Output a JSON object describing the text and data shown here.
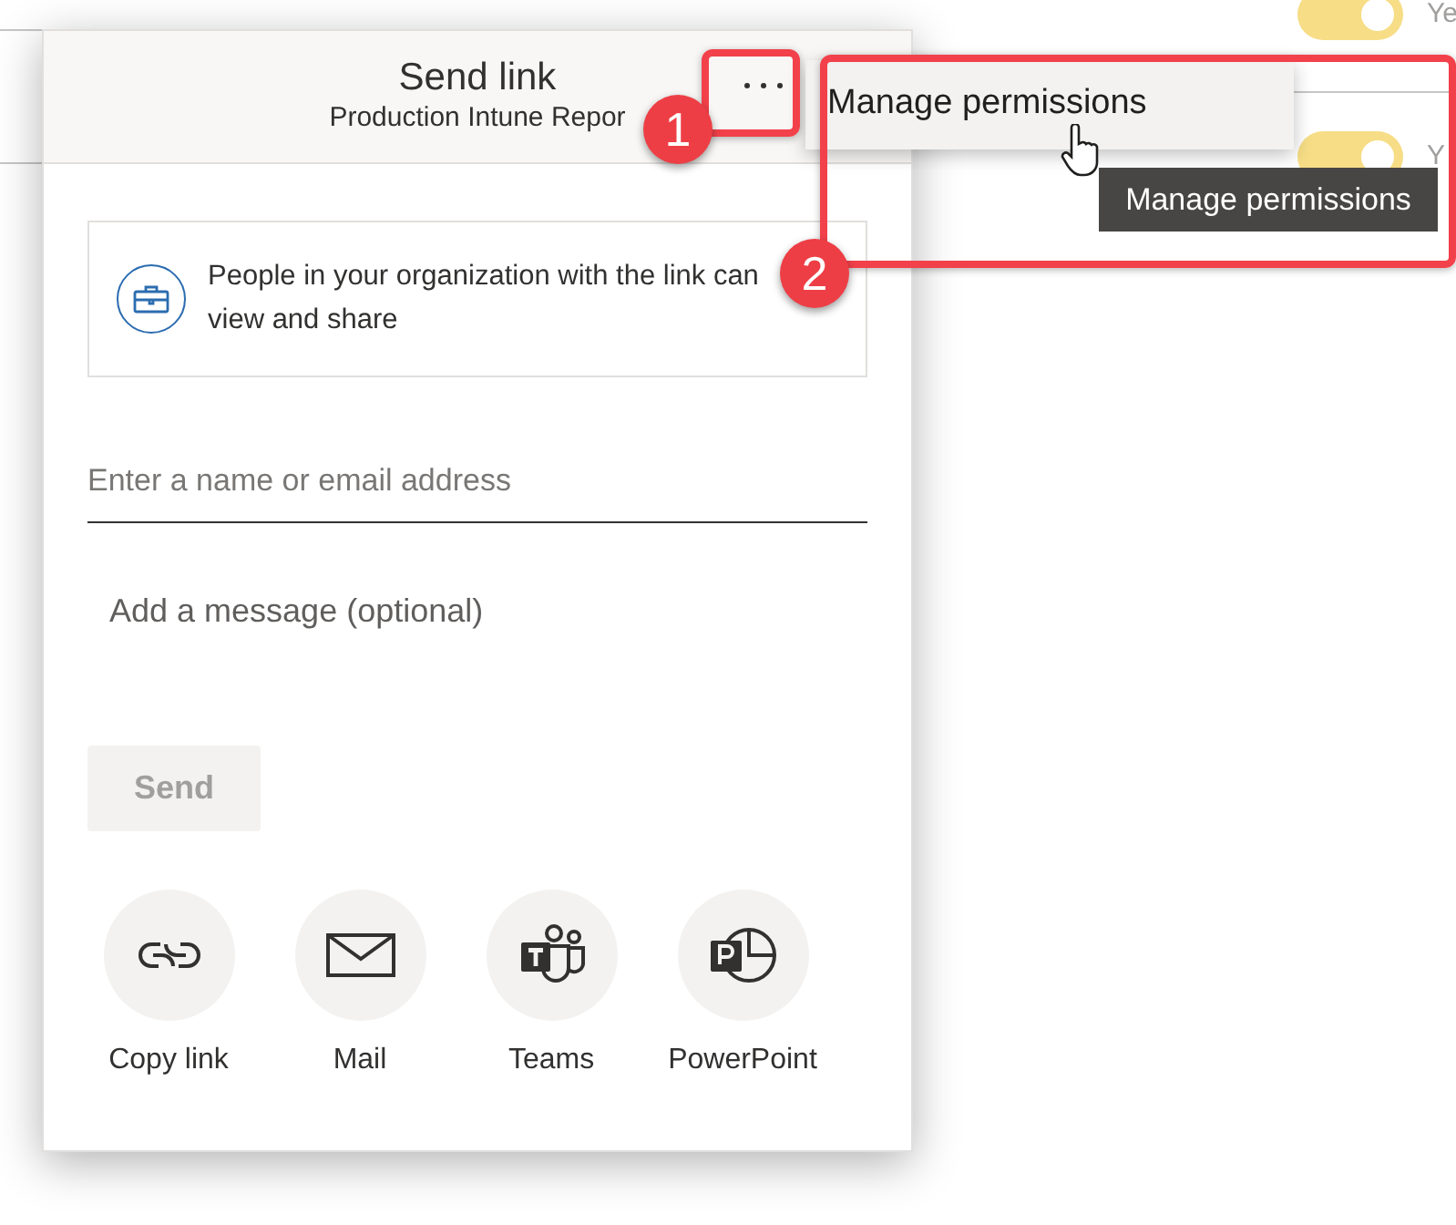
{
  "background": {
    "toggles": [
      {
        "on": true,
        "label": "Ye"
      },
      {
        "on": true,
        "label": "Y"
      }
    ]
  },
  "dialog": {
    "title": "Send link",
    "subtitle": "Production Intune Repor",
    "link_settings": {
      "text": "People in your organization with the link can view and share"
    },
    "recipient": {
      "placeholder": "Enter a name or email address"
    },
    "message": {
      "placeholder": "Add a message (optional)"
    },
    "send_button": {
      "label": "Send",
      "disabled": true
    },
    "share_options": [
      {
        "kind": "copy-link",
        "label": "Copy link"
      },
      {
        "kind": "mail",
        "label": "Mail"
      },
      {
        "kind": "teams",
        "label": "Teams"
      },
      {
        "kind": "powerpoint",
        "label": "PowerPoint"
      }
    ]
  },
  "menu": {
    "items": [
      {
        "label": "Manage permissions",
        "hovered": true
      }
    ]
  },
  "tooltip": "Manage permissions",
  "annotations": [
    {
      "number": "1"
    },
    {
      "number": "2"
    }
  ]
}
